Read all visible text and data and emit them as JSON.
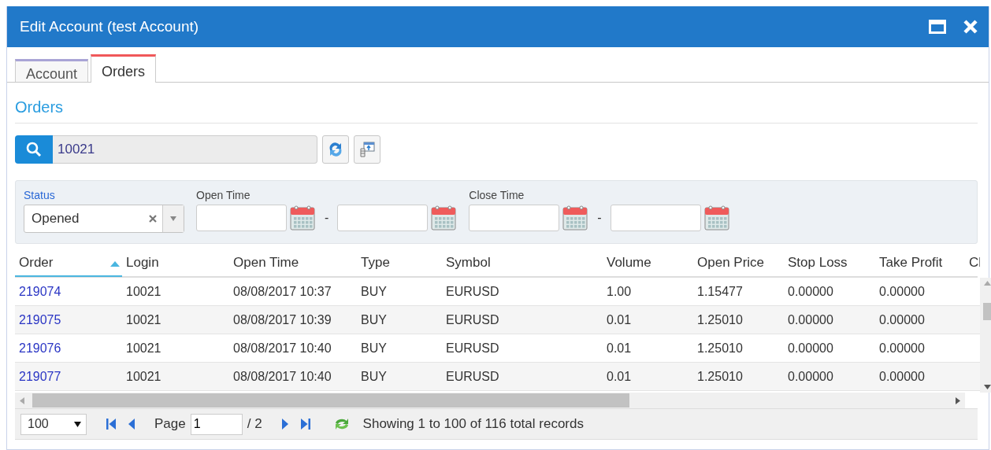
{
  "window": {
    "title": "Edit Account (test Account)"
  },
  "tabs": [
    {
      "label": "Account",
      "selected": false,
      "color": "#a9a4d6"
    },
    {
      "label": "Orders",
      "selected": true,
      "color": "#f0585a"
    }
  ],
  "section_title": "Orders",
  "search": {
    "value": "10021"
  },
  "filters": {
    "status": {
      "label": "Status",
      "value": "Opened"
    },
    "open_time": {
      "label": "Open Time"
    },
    "close_time": {
      "label": "Close Time"
    },
    "separator": "-"
  },
  "table": {
    "columns": [
      {
        "label": "Order",
        "sorted": true
      },
      {
        "label": "Login",
        "sorted": false
      },
      {
        "label": "Open Time",
        "sorted": false
      },
      {
        "label": "Type",
        "sorted": false
      },
      {
        "label": "Symbol",
        "sorted": false
      },
      {
        "label": "Volume",
        "sorted": false
      },
      {
        "label": "Open Price",
        "sorted": false
      },
      {
        "label": "Stop Loss",
        "sorted": false
      },
      {
        "label": "Take Profit",
        "sorted": false
      },
      {
        "label": "Cl",
        "sorted": false
      }
    ],
    "rows": [
      [
        "219074",
        "10021",
        "08/08/2017 10:37",
        "BUY",
        "EURUSD",
        "1.00",
        "1.15477",
        "0.00000",
        "0.00000"
      ],
      [
        "219075",
        "10021",
        "08/08/2017 10:39",
        "BUY",
        "EURUSD",
        "0.01",
        "1.25010",
        "0.00000",
        "0.00000"
      ],
      [
        "219076",
        "10021",
        "08/08/2017 10:40",
        "BUY",
        "EURUSD",
        "0.01",
        "1.25010",
        "0.00000",
        "0.00000"
      ],
      [
        "219077",
        "10021",
        "08/08/2017 10:40",
        "BUY",
        "EURUSD",
        "0.01",
        "1.25010",
        "0.00000",
        "0.00000"
      ]
    ]
  },
  "pager": {
    "page_size": "100",
    "page_label": "Page",
    "page": "1",
    "page_total": "/ 2",
    "summary": "Showing 1 to 100 of 116 total records"
  }
}
